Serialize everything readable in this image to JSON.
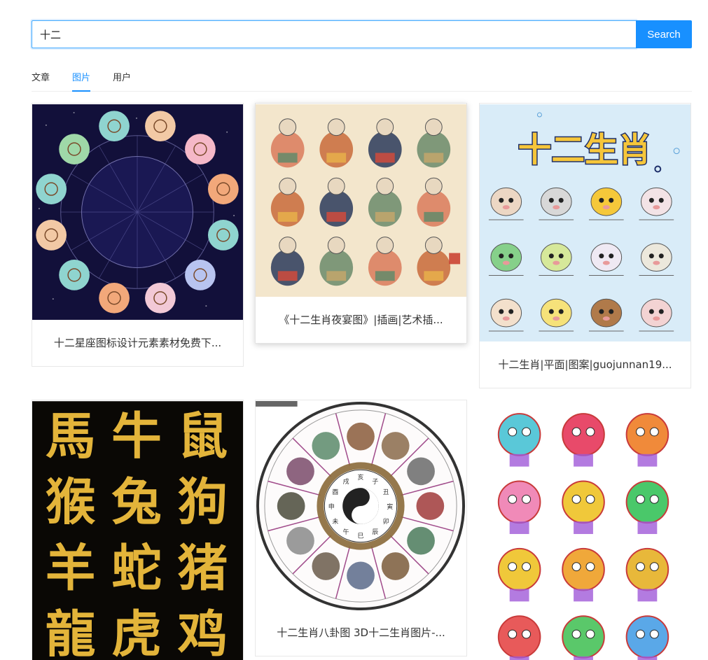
{
  "search": {
    "value": "十二",
    "button_label": "Search"
  },
  "tabs": [
    {
      "label": "文章",
      "active": false
    },
    {
      "label": "图片",
      "active": true
    },
    {
      "label": "用户",
      "active": false
    }
  ],
  "results": [
    {
      "caption": "十二星座图标设计元素素材免费下..."
    },
    {
      "caption": "《十二生肖夜宴图》|插画|艺术插..."
    },
    {
      "caption": "十二生肖|平面|图案|guojunnan19..."
    },
    {
      "caption": ""
    },
    {
      "caption": "十二生肖八卦图 3D十二生肖图片-..."
    },
    {
      "caption": ""
    }
  ],
  "image_text": {
    "zodiac_title": "十二生肖",
    "calligraphy": [
      "馬",
      "牛",
      "鼠",
      "猴",
      "兔",
      "狗",
      "羊",
      "蛇",
      "猪",
      "龍",
      "虎",
      "鸡"
    ],
    "bagua_labels": [
      "子",
      "丑",
      "寅",
      "卯",
      "辰",
      "巳",
      "午",
      "未",
      "申",
      "酉",
      "戌",
      "亥"
    ]
  },
  "colors": {
    "accent": "#1890ff",
    "night_sky": "#12103a",
    "scroll_bg": "#f3e6cc",
    "light_blue_bg": "#d9ecf8",
    "calligraphy_bg": "#0a0805",
    "gold": "#e3b43a"
  }
}
